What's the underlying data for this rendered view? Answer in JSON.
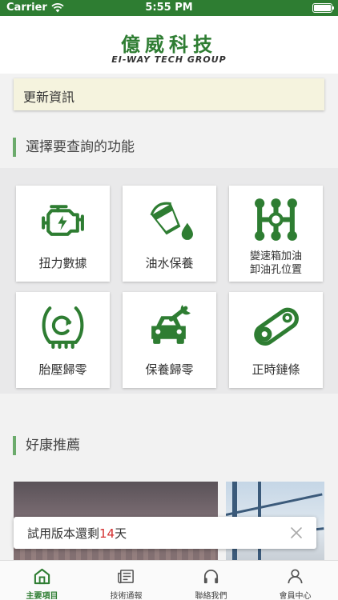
{
  "status_bar": {
    "carrier": "Carrier",
    "time": "5:55 PM"
  },
  "header": {
    "logo_zh": "億威科技",
    "logo_en": "EI-WAY TECH GROUP"
  },
  "news": {
    "label": "更新資訊"
  },
  "functions": {
    "title": "選擇要查詢的功能",
    "items": [
      {
        "label": "扭力數據",
        "icon": "engine-icon"
      },
      {
        "label": "油水保養",
        "icon": "oil-bucket-icon"
      },
      {
        "label_line1": "變速箱加油",
        "label_line2": "卸油孔位置",
        "icon": "gear-shift-icon"
      },
      {
        "label": "胎壓歸零",
        "icon": "tire-pressure-icon"
      },
      {
        "label": "保養歸零",
        "icon": "car-wrench-icon"
      },
      {
        "label": "正時鏈條",
        "icon": "timing-chain-icon"
      }
    ]
  },
  "promotions": {
    "title": "好康推薦"
  },
  "toast": {
    "prefix": "試用版本還剩",
    "days": "14",
    "suffix": "天"
  },
  "tabs": [
    {
      "label": "主要項目",
      "icon": "home-icon",
      "active": true
    },
    {
      "label": "技術通報",
      "icon": "news-icon",
      "active": false
    },
    {
      "label": "聯絡我們",
      "icon": "headset-icon",
      "active": false
    },
    {
      "label": "會員中心",
      "icon": "user-icon",
      "active": false
    }
  ],
  "colors": {
    "brand": "#2e7d32",
    "accent_bar": "#6cab6c",
    "notice_bg": "#f5f3de",
    "toast_days": "#d32f2f"
  }
}
